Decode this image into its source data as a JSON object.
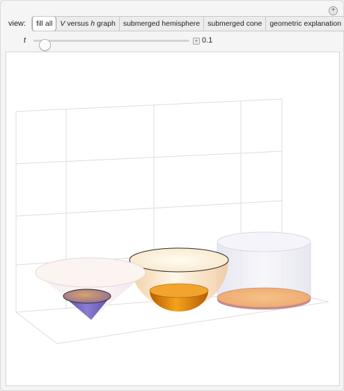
{
  "controls": {
    "view_label": "view:",
    "view_options": [
      {
        "label": "fill all",
        "active": true
      },
      {
        "label_pre": "",
        "label_var": "V",
        "label_mid": " versus ",
        "label_var2": "h",
        "label_post": " graph",
        "active": false
      },
      {
        "label": "submerged hemisphere",
        "active": false
      },
      {
        "label": "submerged cone",
        "active": false
      },
      {
        "label": "geometric explanation",
        "active": false
      }
    ],
    "slider_label": "t",
    "slider_value": "0.1",
    "slider_fraction": 0.0
  },
  "colors": {
    "cone_fill": "#7d6fc4",
    "hemisphere_fill": "#e8910f",
    "cylinder_fill": "#f0b77a"
  },
  "icons": {
    "corner": "plus-icon",
    "slider_add": "plus-icon"
  }
}
